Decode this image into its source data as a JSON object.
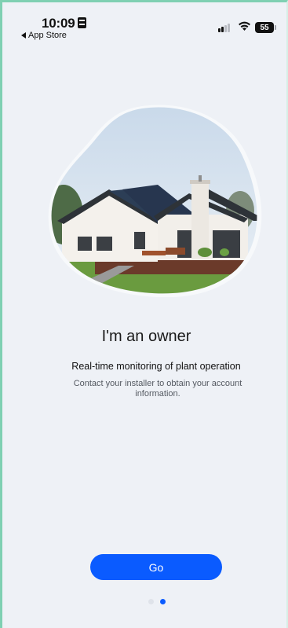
{
  "status_bar": {
    "time": "10:09",
    "back_app": "App Store",
    "battery": "55",
    "icons": [
      "id-card-icon",
      "cellular-signal-icon",
      "wifi-icon",
      "battery-icon",
      "back-arrow-icon"
    ]
  },
  "onboarding": {
    "hero_image": "house-with-solar-panels-image",
    "title": "I'm an owner",
    "subtitle": "Real-time monitoring of plant operation",
    "description": "Contact your installer to obtain your account information.",
    "go_label": "Go",
    "page_index": 2,
    "page_count": 2
  },
  "colors": {
    "accent": "#0a5bff",
    "background": "#eef1f6",
    "frame_border": "#7fd0b2"
  }
}
